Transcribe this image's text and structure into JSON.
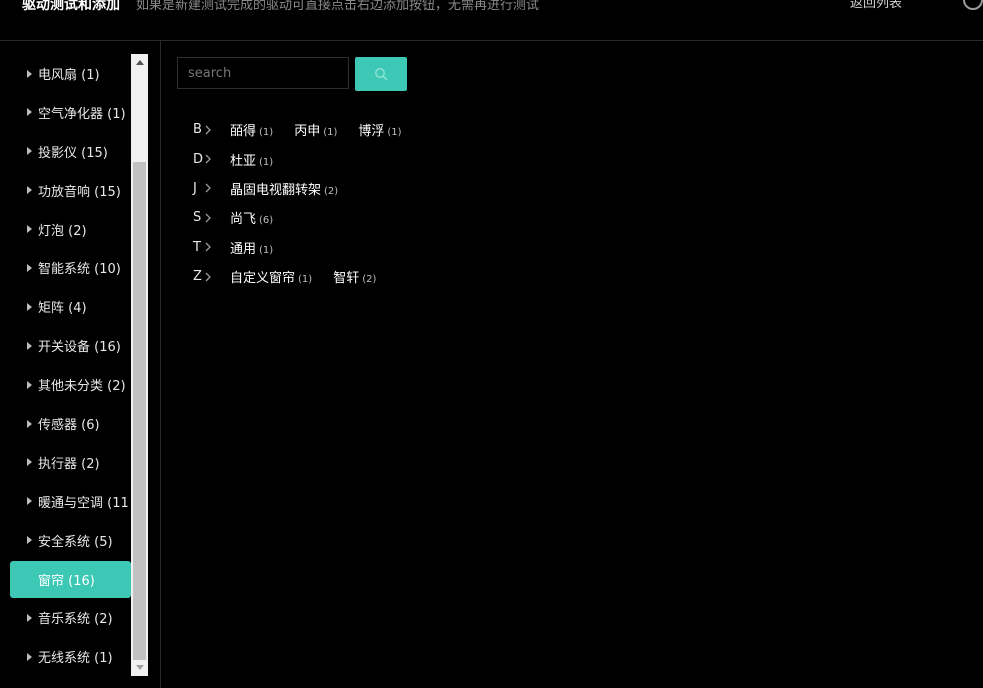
{
  "header": {
    "title": "驱动测试和添加",
    "description": "如果是新建测试完成的驱动可直接点击右边添加按钮，无需再进行测试",
    "right_text": "返回列表"
  },
  "search": {
    "placeholder": "search",
    "value": ""
  },
  "sidebar": {
    "items": [
      {
        "label": "电风扇 (1)"
      },
      {
        "label": "空气净化器 (1)"
      },
      {
        "label": "投影仪 (15)"
      },
      {
        "label": "功放音响 (15)"
      },
      {
        "label": "灯泡 (2)"
      },
      {
        "label": "智能系统 (10)"
      },
      {
        "label": "矩阵 (4)"
      },
      {
        "label": "开关设备 (16)"
      },
      {
        "label": "其他未分类 (2)"
      },
      {
        "label": "传感器 (6)"
      },
      {
        "label": "执行器 (2)"
      },
      {
        "label": "暖通与空调 (11"
      },
      {
        "label": "安全系统 (5)"
      },
      {
        "label": "窗帘 (16)",
        "active": true
      },
      {
        "label": "音乐系统 (2)"
      },
      {
        "label": "无线系统 (1)"
      }
    ]
  },
  "brand_groups": [
    {
      "letter": "B",
      "brands": [
        {
          "name": "皕得",
          "count": "(1)"
        },
        {
          "name": "丙申",
          "count": "(1)"
        },
        {
          "name": "博浮",
          "count": "(1)"
        }
      ]
    },
    {
      "letter": "D",
      "brands": [
        {
          "name": "杜亚",
          "count": "(1)"
        }
      ]
    },
    {
      "letter": "J",
      "brands": [
        {
          "name": "晶固电视翻转架",
          "count": "(2)"
        }
      ]
    },
    {
      "letter": "S",
      "brands": [
        {
          "name": "尚飞",
          "count": "(6)"
        }
      ]
    },
    {
      "letter": "T",
      "brands": [
        {
          "name": "通用",
          "count": "(1)"
        }
      ]
    },
    {
      "letter": "Z",
      "brands": [
        {
          "name": "自定义窗帘",
          "count": "(1)"
        },
        {
          "name": "智轩",
          "count": "(2)"
        }
      ]
    }
  ],
  "colors": {
    "accent": "#3cc8b4",
    "background": "#000000"
  },
  "icons": {
    "search": "search-icon",
    "chevron": "chevron-right-icon",
    "caret": "caret-right-icon"
  }
}
